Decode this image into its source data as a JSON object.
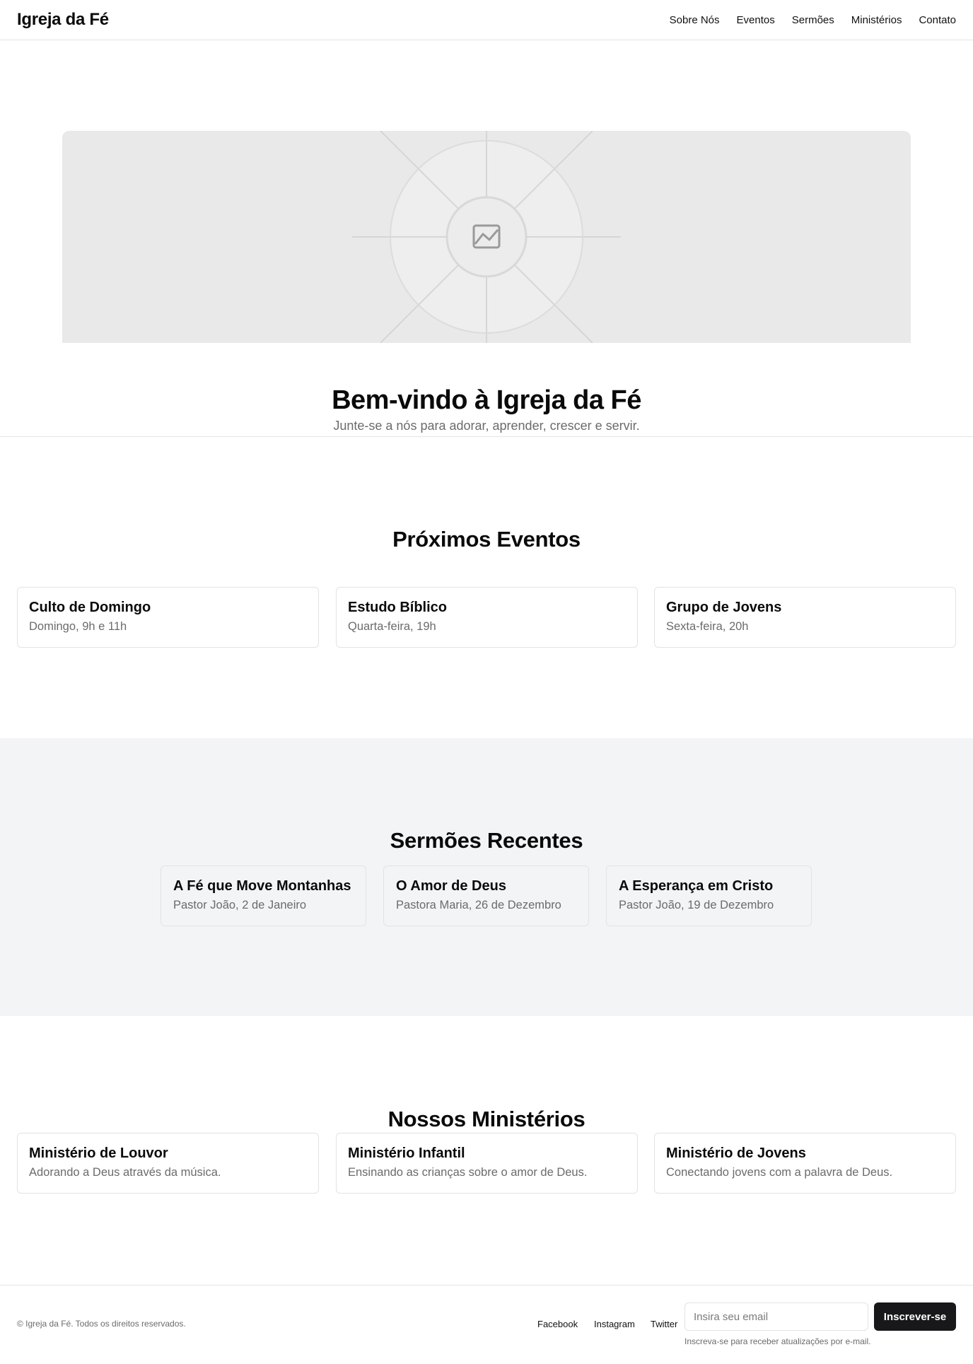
{
  "header": {
    "brand": "Igreja da Fé",
    "nav": [
      "Sobre Nós",
      "Eventos",
      "Sermões",
      "Ministérios",
      "Contato"
    ]
  },
  "hero": {
    "image_icon": "image-placeholder-icon",
    "title": "Bem-vindo à Igreja da Fé",
    "subtitle": "Junte-se a nós para adorar, aprender, crescer e servir."
  },
  "events": {
    "title": "Próximos Eventos",
    "items": [
      {
        "title": "Culto de Domingo",
        "detail": "Domingo, 9h e 11h"
      },
      {
        "title": "Estudo Bíblico",
        "detail": "Quarta-feira, 19h"
      },
      {
        "title": "Grupo de Jovens",
        "detail": "Sexta-feira, 20h"
      }
    ]
  },
  "sermons": {
    "title": "Sermões Recentes",
    "items": [
      {
        "title": "A Fé que Move Montanhas",
        "detail": "Pastor João, 2 de Janeiro"
      },
      {
        "title": "O Amor de Deus",
        "detail": "Pastora Maria, 26 de Dezembro"
      },
      {
        "title": "A Esperança em Cristo",
        "detail": "Pastor João, 19 de Dezembro"
      }
    ]
  },
  "ministries": {
    "title": "Nossos Ministérios",
    "items": [
      {
        "title": "Ministério de Louvor",
        "detail": "Adorando a Deus através da música."
      },
      {
        "title": "Ministério Infantil",
        "detail": "Ensinando as crianças sobre o amor de Deus."
      },
      {
        "title": "Ministério de Jovens",
        "detail": "Conectando jovens com a palavra de Deus."
      }
    ]
  },
  "footer": {
    "copyright": "© Igreja da Fé. Todos os direitos reservados.",
    "social": [
      "Facebook",
      "Instagram",
      "Twitter"
    ],
    "email_placeholder": "Insira seu email",
    "subscribe_label": "Inscrever-se",
    "subscribe_note": "Inscreva-se para receber atualizações por e-mail."
  },
  "colors": {
    "accent_button": "#18181b",
    "muted_text": "#6b6b6b",
    "section_bg": "#f3f4f6"
  }
}
